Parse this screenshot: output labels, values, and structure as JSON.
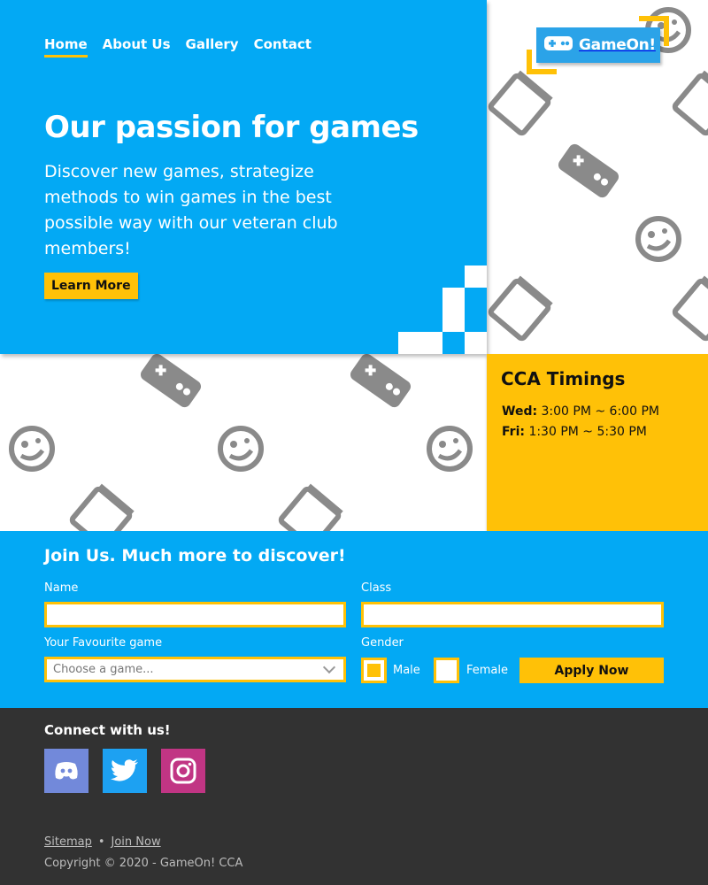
{
  "nav": {
    "items": [
      "Home",
      "About Us",
      "Gallery",
      "Contact"
    ],
    "active": "Home"
  },
  "logo": {
    "text": "GameOn!",
    "icon": "gamepad-icon"
  },
  "hero": {
    "title": "Our passion for games",
    "description": "Discover new games, strategize methods to win games in the best possible way with our veteran club members!",
    "button": "Learn More"
  },
  "timings": {
    "title": "CCA Timings",
    "rows": [
      {
        "day": "Wed:",
        "time": "3:00 PM ~ 6:00 PM"
      },
      {
        "day": "Fri:",
        "time": "1:30 PM ~ 5:30 PM"
      }
    ]
  },
  "join": {
    "title": "Join Us. Much more to discover!",
    "name_label": "Name",
    "name_value": "",
    "class_label": "Class",
    "class_value": "",
    "game_label": "Your Favourite game",
    "game_placeholder": "Choose a game...",
    "gender_label": "Gender",
    "gender_options": [
      "Male",
      "Female"
    ],
    "gender_selected": "Male",
    "apply_button": "Apply Now"
  },
  "footer": {
    "connect": "Connect with us!",
    "social": [
      {
        "name": "discord-icon",
        "color": "#7289da"
      },
      {
        "name": "twitter-icon",
        "color": "#1da1f2"
      },
      {
        "name": "instagram-icon",
        "color": "#c13584"
      }
    ],
    "links": [
      "Sitemap",
      "Join Now"
    ],
    "separator": "•",
    "copyright": "Copyright © 2020 - GameOn! CCA"
  },
  "colors": {
    "primary": "#03a9f4",
    "accent": "#ffc107",
    "dark": "#323232",
    "pattern": "#8a8a8a"
  }
}
